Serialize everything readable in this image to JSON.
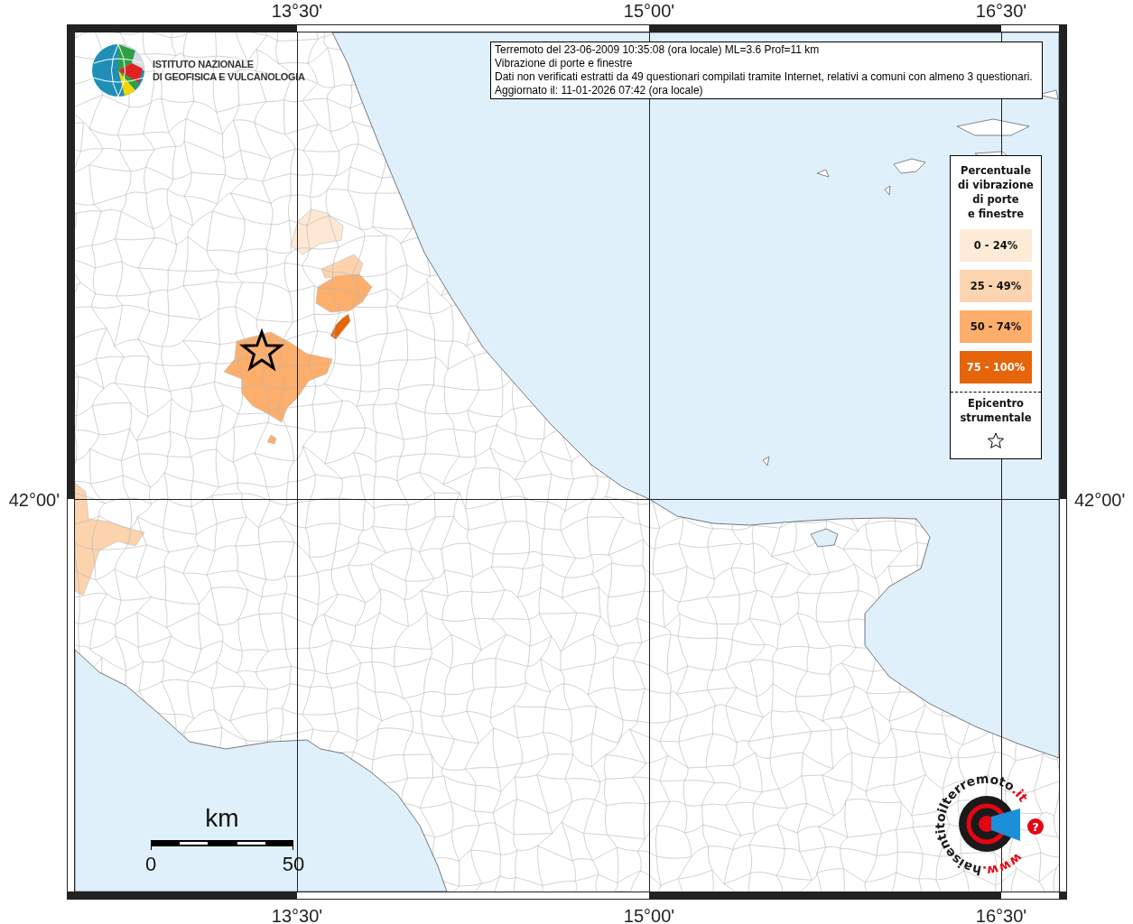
{
  "map": {
    "top_labels": [
      "13°30'",
      "15°00'",
      "16°30'"
    ],
    "bottom_labels": [
      "13°30'",
      "15°00'",
      "16°30'"
    ],
    "left_labels": [
      "42°00'"
    ],
    "right_labels": [
      "42°00'"
    ],
    "shaded_areas": [
      {
        "color": "#fde9d3"
      },
      {
        "color": "#fdd3ae"
      },
      {
        "color": "#fdae6b"
      },
      {
        "color": "#e6640a"
      },
      {
        "color": "#fdae6b"
      },
      {
        "color": "#fdae6b"
      },
      {
        "color": "#fdd3ae"
      }
    ],
    "scale_bar": {
      "unit": "km",
      "start": "0",
      "end": "50"
    }
  },
  "ingv_logo": {
    "lines": [
      "ISTITUTO NAZIONALE",
      "DI GEOFISICA E VULCANOLOGIA"
    ]
  },
  "info_box": {
    "lines": [
      "Terremoto del 23-06-2009 10:35:08 (ora locale) ML=3.6 Prof=11 km",
      "Vibrazione di porte e finestre",
      "Dati non verificati estratti da 49 questionari compilati tramite Internet, relativi a comuni con almeno 3 questionari.",
      "Aggiornato il: 11-01-2026 07:42 (ora locale)"
    ]
  },
  "legend": {
    "title_lines": [
      "Percentuale",
      "di vibrazione",
      "di porte",
      "e finestre"
    ],
    "items": [
      {
        "label": "0 - 24%",
        "color": "#fdebd7"
      },
      {
        "label": "25 - 49%",
        "color": "#fdd4b0"
      },
      {
        "label": "50 - 74%",
        "color": "#fdae6b"
      },
      {
        "label": "75 - 100%",
        "color": "#e6640a"
      }
    ],
    "epicenter_label": "Epicentro strumentale"
  },
  "hst_logo": {
    "prefix": "www.",
    "name": "haisentitoilterremoto",
    "suffix": ".it",
    "badge": "?"
  }
}
